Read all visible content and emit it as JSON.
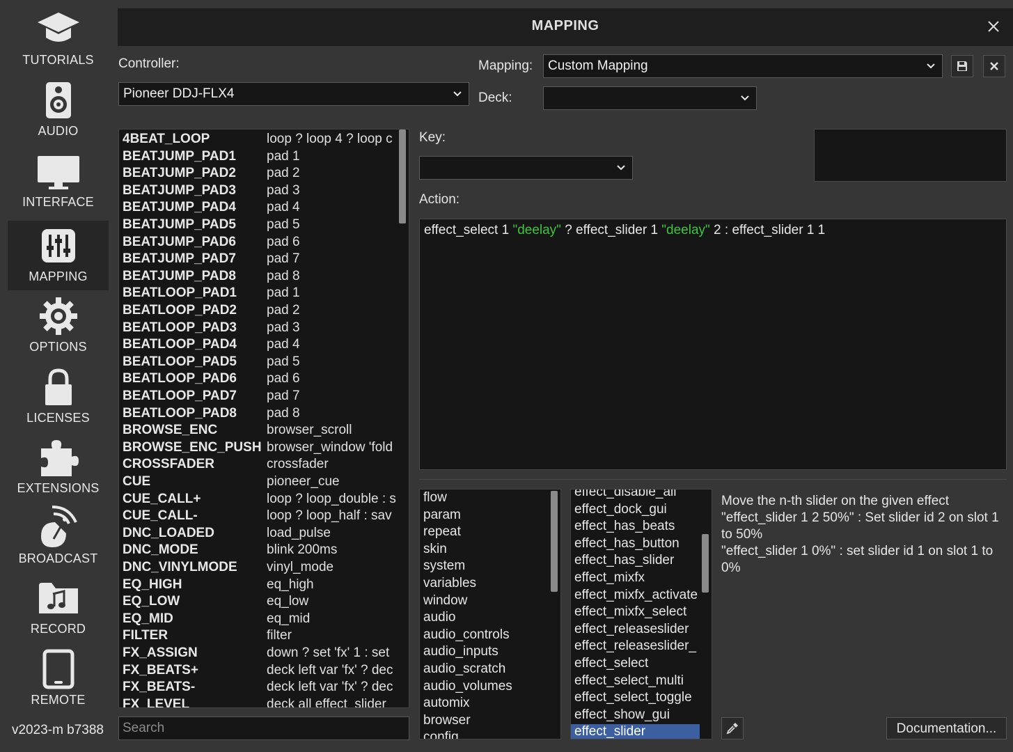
{
  "sidebar": {
    "items": [
      {
        "label": "TUTORIALS",
        "icon": "graduation-cap-icon"
      },
      {
        "label": "AUDIO",
        "icon": "speaker-icon"
      },
      {
        "label": "INTERFACE",
        "icon": "monitor-icon"
      },
      {
        "label": "MAPPING",
        "icon": "sliders-icon",
        "active": true
      },
      {
        "label": "OPTIONS",
        "icon": "gear-icon"
      },
      {
        "label": "LICENSES",
        "icon": "lock-icon"
      },
      {
        "label": "EXTENSIONS",
        "icon": "puzzle-icon"
      },
      {
        "label": "BROADCAST",
        "icon": "satellite-icon"
      },
      {
        "label": "RECORD",
        "icon": "music-folder-icon"
      },
      {
        "label": "REMOTE",
        "icon": "tablet-icon"
      }
    ],
    "version": "v2023-m b7388"
  },
  "dialog": {
    "title": "MAPPING",
    "controller_label": "Controller:",
    "controller_value": "Pioneer DDJ-FLX4",
    "mapping_label": "Mapping:",
    "mapping_value": "Custom Mapping",
    "deck_label": "Deck:",
    "deck_value": "",
    "key_label": "Key:",
    "key_value": "",
    "action_label": "Action:",
    "action_parts": [
      {
        "t": "effect_select 1 ",
        "s": false
      },
      {
        "t": "\"deelay\"",
        "s": true
      },
      {
        "t": " ? effect_slider 1 ",
        "s": false
      },
      {
        "t": "\"deelay\"",
        "s": true
      },
      {
        "t": " 2 : effect_slider 1 1",
        "s": false
      }
    ],
    "search_placeholder": "Search",
    "documentation_label": "Documentation..."
  },
  "mappings": [
    {
      "key": "4BEAT_LOOP",
      "action": "loop ? loop 4 ? loop c"
    },
    {
      "key": "BEATJUMP_PAD1",
      "action": "pad 1"
    },
    {
      "key": "BEATJUMP_PAD2",
      "action": "pad 2"
    },
    {
      "key": "BEATJUMP_PAD3",
      "action": "pad 3"
    },
    {
      "key": "BEATJUMP_PAD4",
      "action": "pad 4"
    },
    {
      "key": "BEATJUMP_PAD5",
      "action": "pad 5"
    },
    {
      "key": "BEATJUMP_PAD6",
      "action": "pad 6"
    },
    {
      "key": "BEATJUMP_PAD7",
      "action": "pad 7"
    },
    {
      "key": "BEATJUMP_PAD8",
      "action": "pad 8"
    },
    {
      "key": "BEATLOOP_PAD1",
      "action": "pad 1"
    },
    {
      "key": "BEATLOOP_PAD2",
      "action": "pad 2"
    },
    {
      "key": "BEATLOOP_PAD3",
      "action": "pad 3"
    },
    {
      "key": "BEATLOOP_PAD4",
      "action": "pad 4"
    },
    {
      "key": "BEATLOOP_PAD5",
      "action": "pad 5"
    },
    {
      "key": "BEATLOOP_PAD6",
      "action": "pad 6"
    },
    {
      "key": "BEATLOOP_PAD7",
      "action": "pad 7"
    },
    {
      "key": "BEATLOOP_PAD8",
      "action": "pad 8"
    },
    {
      "key": "BROWSE_ENC",
      "action": "browser_scroll"
    },
    {
      "key": "BROWSE_ENC_PUSH",
      "action": "browser_window 'fold"
    },
    {
      "key": "CROSSFADER",
      "action": "crossfader"
    },
    {
      "key": "CUE",
      "action": "pioneer_cue"
    },
    {
      "key": "CUE_CALL+",
      "action": "loop ? loop_double : s"
    },
    {
      "key": "CUE_CALL-",
      "action": "loop ? loop_half : sav"
    },
    {
      "key": "DNC_LOADED",
      "action": "load_pulse"
    },
    {
      "key": "DNC_MODE",
      "action": "blink 200ms"
    },
    {
      "key": "DNC_VINYLMODE",
      "action": "vinyl_mode"
    },
    {
      "key": "EQ_HIGH",
      "action": "eq_high"
    },
    {
      "key": "EQ_LOW",
      "action": "eq_low"
    },
    {
      "key": "EQ_MID",
      "action": "eq_mid"
    },
    {
      "key": "FILTER",
      "action": "filter"
    },
    {
      "key": "FX_ASSIGN",
      "action": "down ? set 'fx' 1  : set"
    },
    {
      "key": "FX_BEATS+",
      "action": "deck left var 'fx' ? dec"
    },
    {
      "key": "FX_BEATS-",
      "action": "deck left var 'fx' ? dec"
    },
    {
      "key": "FX_LEVEL",
      "action": "deck all effect_slider"
    }
  ],
  "categories": [
    "flow",
    "param",
    "repeat",
    "skin",
    "system",
    "variables",
    "window",
    "audio",
    "audio_controls",
    "audio_inputs",
    "audio_scratch",
    "audio_volumes",
    "automix",
    "browser",
    "config"
  ],
  "commands": [
    "effect_disable_all",
    "effect_dock_gui",
    "effect_has_beats",
    "effect_has_button",
    "effect_has_slider",
    "effect_mixfx",
    "effect_mixfx_activate",
    "effect_mixfx_select",
    "effect_releaseslider",
    "effect_releaseslider_",
    "effect_select",
    "effect_select_multi",
    "effect_select_toggle",
    "effect_show_gui",
    "effect_slider"
  ],
  "selected_command": "effect_slider",
  "help": {
    "line1": "Move the n-th slider on the given effect",
    "line2": "\"effect_slider 1 2 50%\" : Set slider id 2 on slot 1 to 50%",
    "line3": "\"effect_slider 1 0%\" : set slider id 1 on slot 1 to 0%"
  }
}
